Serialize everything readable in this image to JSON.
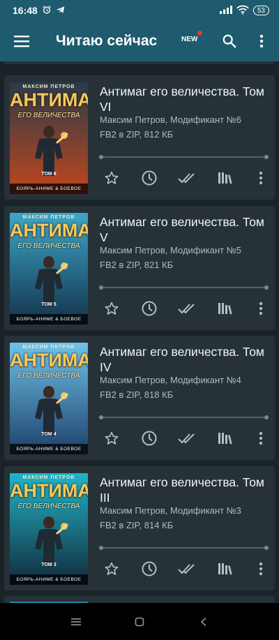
{
  "status_bar": {
    "time": "16:48",
    "battery": "53"
  },
  "app_bar": {
    "title": "Читаю сейчас",
    "new_badge": "NEW"
  },
  "books": [
    {
      "title": "Антимаг его величества. Том VI",
      "author": "Максим Петров, Модификант №6",
      "file": "FB2 в ZIP, 812 КБ",
      "progress": 1.0,
      "cover": {
        "author": "МАКСИМ ПЕТРОВ",
        "title": "АНТИМАГ",
        "subtitle": "ЕГО ВЕЛИЧЕСТВА",
        "volume": "ТОМ 6",
        "genre": "БОЯРЬ-АНИМЕ & БОЕВОЕ ФЭНТЕЗИ",
        "bg_top": "#2a3b4a",
        "bg_bottom": "#c2461b"
      }
    },
    {
      "title": "Антимаг его величества. Том V",
      "author": "Максим Петров, Модификант №5",
      "file": "FB2 в ZIP, 821 КБ",
      "progress": 1.0,
      "cover": {
        "author": "МАКСИМ ПЕТРОВ",
        "title": "АНТИМАГ",
        "subtitle": "ЕГО ВЕЛИЧЕСТВА",
        "volume": "ТОМ 5",
        "genre": "БОЯРЬ-АНИМЕ & БОЕВОЕ ФЭНТЕЗИ",
        "bg_top": "#3fa7c9",
        "bg_bottom": "#12324a"
      }
    },
    {
      "title": "Антимаг его величества. Том IV",
      "author": "Максим Петров, Модификант №4",
      "file": "FB2 в ZIP, 818 КБ",
      "progress": 1.0,
      "cover": {
        "author": "МАКСИМ ПЕТРОВ",
        "title": "АНТИМАГ",
        "subtitle": "ЕГО ВЕЛИЧЕСТВА",
        "volume": "ТОМ 4",
        "genre": "БОЯРЬ-АНИМЕ & БОЕВОЕ ФЭНТЕЗИ",
        "bg_top": "#6fc3e8",
        "bg_bottom": "#1d3f6a"
      }
    },
    {
      "title": "Антимаг его величества. Том III",
      "author": "Максим Петров, Модификант №3",
      "file": "FB2 в ZIP, 814 КБ",
      "progress": 1.0,
      "cover": {
        "author": "МАКСИМ ПЕТРОВ",
        "title": "АНТИМАГ",
        "subtitle": "ЕГО ВЕЛИЧЕСТВА",
        "volume": "ТОМ 3",
        "genre": "БОЯРЬ-АНИМЕ & БОЕВОЕ ФЭНТЕЗИ",
        "bg_top": "#22b5c6",
        "bg_bottom": "#102a3a"
      }
    }
  ],
  "icons": {
    "actions": [
      "star-outline-icon",
      "clock-icon",
      "double-check-icon",
      "library-icon",
      "more-vertical-icon"
    ],
    "nav": [
      "recents-icon",
      "home-icon",
      "back-icon"
    ]
  },
  "colors": {
    "app_bar": "#1f5b6e",
    "card": "#263238",
    "background": "#1a2327",
    "icon": "#b4c0c5"
  }
}
